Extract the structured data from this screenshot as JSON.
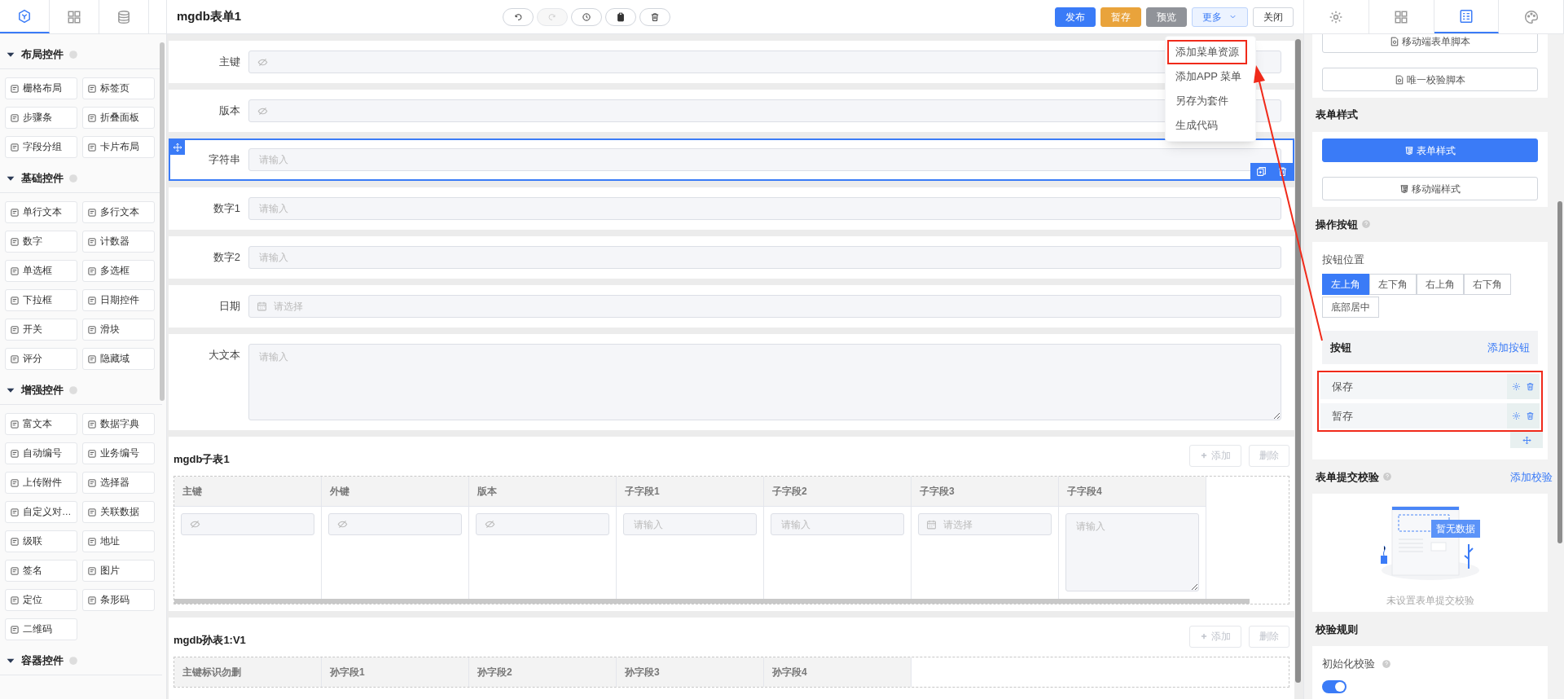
{
  "left_tabs": [
    {
      "selected": true
    },
    {
      "selected": false
    },
    {
      "selected": false
    }
  ],
  "palette": [
    {
      "title": "布局控件",
      "items": [
        "栅格布局",
        "标签页",
        "步骤条",
        "折叠面板",
        "字段分组",
        "卡片布局"
      ]
    },
    {
      "title": "基础控件",
      "items": [
        "单行文本",
        "多行文本",
        "数字",
        "计数器",
        "单选框",
        "多选框",
        "下拉框",
        "日期控件",
        "开关",
        "滑块",
        "评分",
        "隐藏域"
      ]
    },
    {
      "title": "增强控件",
      "items": [
        "富文本",
        "数据字典",
        "自动编号",
        "业务编号",
        "上传附件",
        "选择器",
        "自定义对…",
        "关联数据",
        "级联",
        "地址",
        "签名",
        "图片",
        "定位",
        "条形码",
        "二维码"
      ]
    },
    {
      "title": "容器控件"
    }
  ],
  "header": {
    "title": "mgdb表单1",
    "tools": [
      {
        "kind": "undo",
        "disabled": false
      },
      {
        "kind": "redo",
        "disabled": true
      },
      {
        "kind": "history",
        "disabled": false
      },
      {
        "kind": "clipboard",
        "disabled": false
      },
      {
        "kind": "trash",
        "disabled": false
      }
    ],
    "actions": [
      {
        "label": "发布",
        "kind": "primary"
      },
      {
        "label": "暂存",
        "kind": "warning"
      },
      {
        "label": "预览",
        "kind": "info"
      },
      {
        "label": "更多",
        "kind": "dropdown"
      },
      {
        "label": "关闭",
        "kind": "plain"
      }
    ]
  },
  "more_menu": [
    {
      "label": "添加菜单资源",
      "highlighted": true
    },
    {
      "label": "添加APP 菜单",
      "highlighted": false
    },
    {
      "label": "另存为套件",
      "highlighted": false
    },
    {
      "label": "生成代码",
      "highlighted": false
    }
  ],
  "form_fields": [
    {
      "label": "主键",
      "kind": "hidden",
      "selected": false
    },
    {
      "label": "版本",
      "kind": "hidden",
      "selected": false
    },
    {
      "label": "字符串",
      "kind": "text",
      "placeholder": "请输入",
      "selected": true
    },
    {
      "label": "数字1",
      "kind": "text",
      "placeholder": "请输入",
      "selected": false
    },
    {
      "label": "数字2",
      "kind": "text",
      "placeholder": "请输入",
      "selected": false
    },
    {
      "label": "日期",
      "kind": "date",
      "placeholder": "请选择",
      "selected": false
    },
    {
      "label": "大文本",
      "kind": "textarea",
      "placeholder": "请输入",
      "selected": false
    }
  ],
  "subtables": [
    {
      "title": "mgdb子表1",
      "add_button": "添加",
      "delete_button": "删除",
      "columns": [
        {
          "label": "主键",
          "kind": "hidden"
        },
        {
          "label": "外键",
          "kind": "hidden"
        },
        {
          "label": "版本",
          "kind": "hidden"
        },
        {
          "label": "子字段1",
          "kind": "text",
          "placeholder": "请输入"
        },
        {
          "label": "子字段2",
          "kind": "text",
          "placeholder": "请输入"
        },
        {
          "label": "子字段3",
          "kind": "date",
          "placeholder": "请选择"
        },
        {
          "label": "子字段4",
          "kind": "textarea",
          "placeholder": "请输入"
        }
      ]
    },
    {
      "title": "mgdb孙表1:V1",
      "add_button": "添加",
      "delete_button": "删除",
      "columns": [
        {
          "label": "主键标识勿删"
        },
        {
          "label": "孙字段1"
        },
        {
          "label": "孙字段2"
        },
        {
          "label": "孙字段3"
        },
        {
          "label": "孙字段4"
        }
      ]
    }
  ],
  "right_tabs": [
    {
      "selected": false
    },
    {
      "selected": false
    },
    {
      "selected": true
    },
    {
      "selected": false
    }
  ],
  "right_panel": {
    "script_buttons": [
      "移动端表单脚本",
      "唯一校验脚本"
    ],
    "style_section": {
      "title": "表单样式",
      "buttons": [
        {
          "label": "表单样式",
          "kind": "primary"
        },
        {
          "label": "移动端样式",
          "kind": "plain"
        }
      ]
    },
    "action_section": {
      "title": "操作按钮",
      "position_label": "按钮位置",
      "positions": [
        {
          "label": "左上角",
          "selected": true
        },
        {
          "label": "左下角",
          "selected": false
        },
        {
          "label": "右上角",
          "selected": false
        },
        {
          "label": "右下角",
          "selected": false
        },
        {
          "label": "底部居中",
          "selected": false
        }
      ],
      "list_title": "按钮",
      "add_link": "添加按钮",
      "buttons": [
        "保存",
        "暂存"
      ]
    },
    "validation_section": {
      "title": "表单提交校验",
      "add_link": "添加校验",
      "empty_badge": "暂无数据",
      "empty_text": "未设置表单提交校验"
    },
    "rules_section": {
      "title": "校验规则",
      "toggle_label": "初始化校验",
      "toggle_on": true
    }
  }
}
